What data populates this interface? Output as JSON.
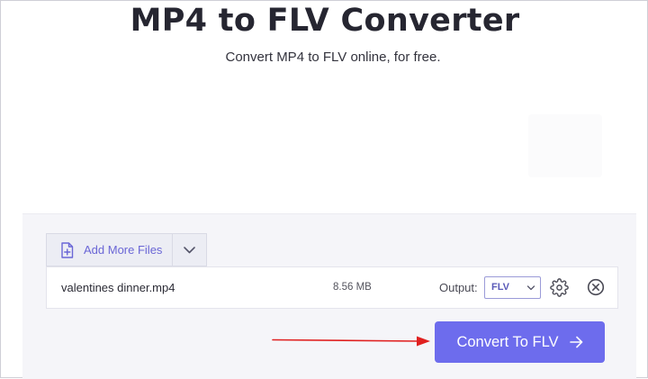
{
  "header": {
    "title": "MP4 to FLV Converter",
    "subtitle": "Convert MP4 to FLV online, for free."
  },
  "toolbar": {
    "add_files_label": "Add More Files",
    "add_files_icon": "file-plus-icon",
    "dropdown_icon": "chevron-down-icon"
  },
  "file": {
    "name": "valentines dinner.mp4",
    "size": "8.56 MB",
    "output_label": "Output:",
    "output_format": "FLV",
    "settings_icon": "gear-icon",
    "remove_icon": "close-circle-icon"
  },
  "actions": {
    "convert_label": "Convert To FLV",
    "convert_icon": "arrow-right-icon"
  },
  "colors": {
    "accent": "#6d6ced",
    "annotation": "#e02020",
    "panel_bg": "#f5f5f9"
  }
}
